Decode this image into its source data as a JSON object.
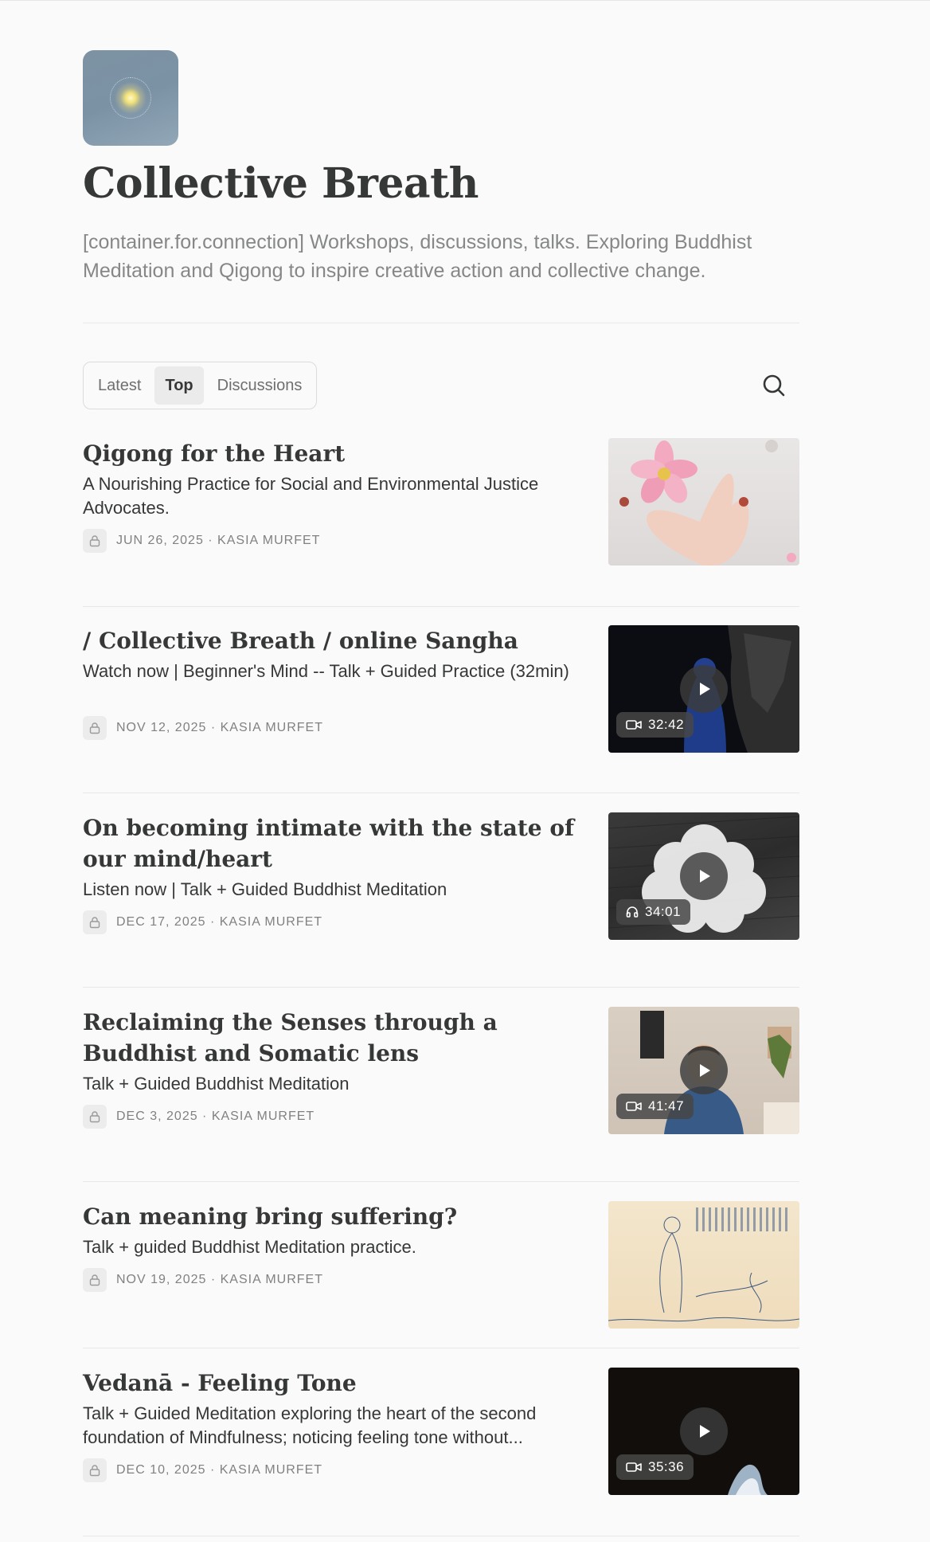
{
  "publication": {
    "title": "Collective Breath",
    "description": "[container.for.connection] Workshops, discussions, talks. Exploring Buddhist Meditation and Qigong to inspire creative action and collective change."
  },
  "tabs": [
    {
      "label": "Latest",
      "active": false
    },
    {
      "label": "Top",
      "active": true
    },
    {
      "label": "Discussions",
      "active": false
    }
  ],
  "posts": [
    {
      "title": "Qigong for the Heart",
      "subtitle": "A Nourishing Practice for Social and Environmental Justice Advocates.",
      "meta": "JUN 26, 2025 · KASIA MURFET",
      "media": null,
      "duration": null
    },
    {
      "title": "/ Collective Breath / online Sangha",
      "subtitle": "Watch now | Beginner's Mind -- Talk + Guided Practice (32min)",
      "meta": "NOV 12, 2025 · KASIA MURFET",
      "media": "video",
      "duration": "32:42"
    },
    {
      "title": "On becoming intimate with the state of our mind/heart",
      "subtitle": "Listen now | Talk + Guided Buddhist Meditation",
      "meta": "DEC 17, 2025 · KASIA MURFET",
      "media": "audio",
      "duration": "34:01"
    },
    {
      "title": "Reclaiming the Senses through a Buddhist and Somatic lens",
      "subtitle": "Talk + Guided Buddhist Meditation",
      "meta": "DEC 3, 2025 · KASIA MURFET",
      "media": "video",
      "duration": "41:47"
    },
    {
      "title": "Can meaning bring suffering?",
      "subtitle": "Talk + guided Buddhist Meditation practice.",
      "meta": "NOV 19, 2025 · KASIA MURFET",
      "media": null,
      "duration": null
    },
    {
      "title": "Vedanā - Feeling Tone",
      "subtitle": "Talk + Guided Meditation exploring the heart of the second foundation of Mindfulness; noticing feeling tone without...",
      "meta": "DEC 10, 2025 · KASIA MURFET",
      "media": "video",
      "duration": "35:36"
    }
  ],
  "icons": {
    "search": "search-icon",
    "lock": "lock-icon",
    "play": "play-icon",
    "video": "video-camera-icon",
    "audio": "headphones-icon"
  },
  "colors": {
    "text": "#363737",
    "muted": "#868787",
    "background": "#fafafa"
  }
}
